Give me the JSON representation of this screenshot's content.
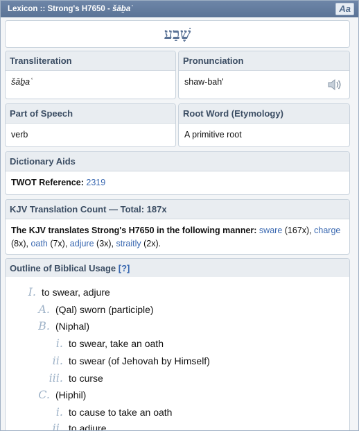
{
  "window": {
    "title_prefix": "Lexicon :: Strong's H7650 - ",
    "title_word": "šāḇaʿ",
    "font_button": "Aa"
  },
  "hebrew_word": "שָׁבַע",
  "transliteration": {
    "label": "Transliteration",
    "value": "šāḇaʿ"
  },
  "pronunciation": {
    "label": "Pronunciation",
    "value": "shaw-bah'",
    "icon": "speaker-icon"
  },
  "part_of_speech": {
    "label": "Part of Speech",
    "value": "verb"
  },
  "root_word": {
    "label": "Root Word (Etymology)",
    "value": "A primitive root"
  },
  "dictionary_aids": {
    "label": "Dictionary Aids",
    "twot_label": "TWOT Reference:",
    "twot_value": "2319"
  },
  "kjv": {
    "label": "KJV Translation Count — Total: 187x",
    "intro": "The KJV translates Strong's H7650 in the following manner:",
    "items": [
      {
        "word": "sware",
        "count": "(167x),"
      },
      {
        "word": "charge",
        "count": "(8x),"
      },
      {
        "word": "oath",
        "count": "(7x),"
      },
      {
        "word": "adjure",
        "count": "(3x),"
      },
      {
        "word": "straitly",
        "count": "(2x)."
      }
    ]
  },
  "outline": {
    "label": "Outline of Biblical Usage",
    "help": "[?]",
    "items": [
      {
        "num": "I.",
        "text": "to swear, adjure"
      },
      {
        "num": "A.",
        "text": "(Qal) sworn (participle)"
      },
      {
        "num": "B.",
        "text": "(Niphal)"
      },
      {
        "num": "i.",
        "text": "to swear, take an oath"
      },
      {
        "num": "ii.",
        "text": "to swear (of Jehovah by Himself)"
      },
      {
        "num": "iii.",
        "text": "to curse"
      },
      {
        "num": "C.",
        "text": "(Hiphil)"
      },
      {
        "num": "i.",
        "text": "to cause to take an oath"
      },
      {
        "num": "ii.",
        "text": "to adjure"
      }
    ]
  }
}
